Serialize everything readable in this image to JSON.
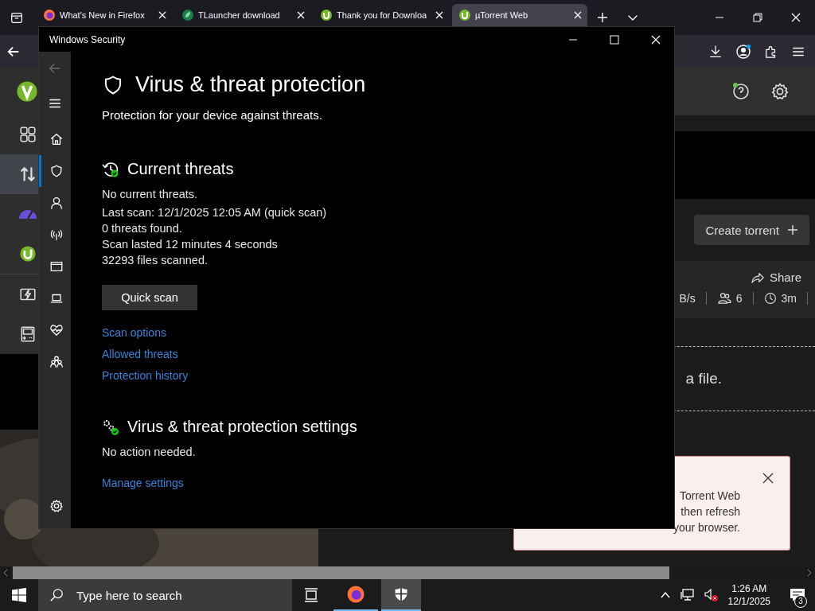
{
  "browser": {
    "tabs": [
      {
        "title": "What's New in Firefox",
        "kind": "firefox",
        "selected": false
      },
      {
        "title": "TLauncher download",
        "kind": "tlauncher",
        "selected": false
      },
      {
        "title": "Thank you for Downloa",
        "kind": "utorrent",
        "selected": false
      },
      {
        "title": "µTorrent Web",
        "kind": "utorrent",
        "selected": true
      }
    ]
  },
  "utorrent": {
    "sidebar": [
      {
        "kind": "logo",
        "selected": false
      },
      {
        "kind": "grid",
        "selected": false
      },
      {
        "kind": "transfer",
        "selected": true
      },
      {
        "kind": "speed",
        "selected": false
      },
      {
        "kind": "utorrent",
        "selected": false
      },
      {
        "kind": "flash",
        "selected": false
      },
      {
        "kind": "games",
        "selected": false
      }
    ],
    "create_button": "Create torrent",
    "share": "Share",
    "stats": [
      "B/s",
      "6",
      "3m"
    ],
    "drop_text": "a file.",
    "notice": {
      "lines": [
        "Torrent Web",
        "then refresh",
        "your browser."
      ]
    }
  },
  "security": {
    "title": "Windows Security",
    "nav": [
      {
        "kind": "home",
        "selected": false
      },
      {
        "kind": "shield",
        "selected": true
      },
      {
        "kind": "person",
        "selected": false
      },
      {
        "kind": "wireless",
        "selected": false
      },
      {
        "kind": "app",
        "selected": false
      },
      {
        "kind": "laptop",
        "selected": false
      },
      {
        "kind": "heart",
        "selected": false
      },
      {
        "kind": "family",
        "selected": false
      }
    ],
    "heading": "Virus & threat protection",
    "subtitle": "Protection for your device against threats.",
    "threats": {
      "heading": "Current threats",
      "lines": [
        "No current threats.",
        "Last scan: 12/1/2025 12:05 AM (quick scan)",
        "0 threats found.",
        "Scan lasted 12 minutes 4 seconds",
        "32293 files scanned."
      ],
      "button": "Quick scan",
      "links": [
        "Scan options",
        "Allowed threats",
        "Protection history"
      ]
    },
    "settings": {
      "heading": "Virus & threat protection settings",
      "status": "No action needed.",
      "link": "Manage settings"
    }
  },
  "taskbar": {
    "search_placeholder": "Type here to search",
    "apps": [
      {
        "kind": "taskview",
        "selected": false
      },
      {
        "kind": "firefox",
        "selected": false
      },
      {
        "kind": "security",
        "selected": true
      }
    ],
    "time": "1:26 AM",
    "date": "12/1/2025",
    "notifications": "3"
  }
}
